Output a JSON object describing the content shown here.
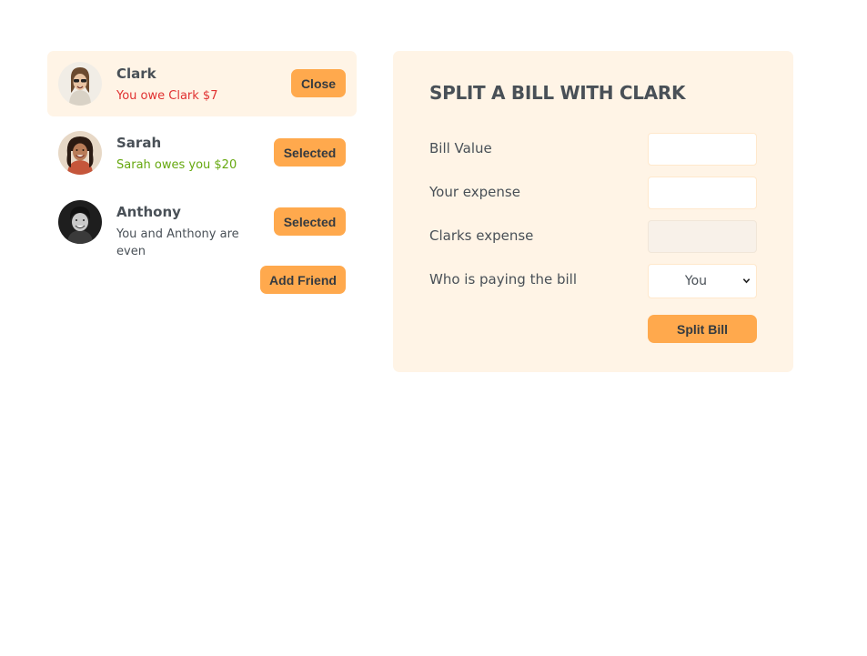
{
  "friends": [
    {
      "name": "Clark",
      "status": "You owe Clark $7",
      "button": "Close"
    },
    {
      "name": "Sarah",
      "status": "Sarah owes you $20",
      "button": "Selected"
    },
    {
      "name": "Anthony",
      "status": "You and Anthony are even",
      "button": "Selected"
    }
  ],
  "add_friend_label": "Add Friend",
  "form": {
    "title": "SPLIT A BILL WITH CLARK",
    "bill_value_label": "Bill Value",
    "bill_value": "",
    "your_expense_label": "Your expense",
    "your_expense": "",
    "friend_expense_label": "Clarks expense",
    "friend_expense": "",
    "who_pays_label": "Who is paying the bill",
    "who_pays_value": "You",
    "submit_label": "Split Bill"
  },
  "colors": {
    "accent": "#ffa94d",
    "panel_bg": "#fff4e6",
    "owe_red": "#e03131",
    "owed_green": "#66a80f",
    "text": "#495057"
  }
}
